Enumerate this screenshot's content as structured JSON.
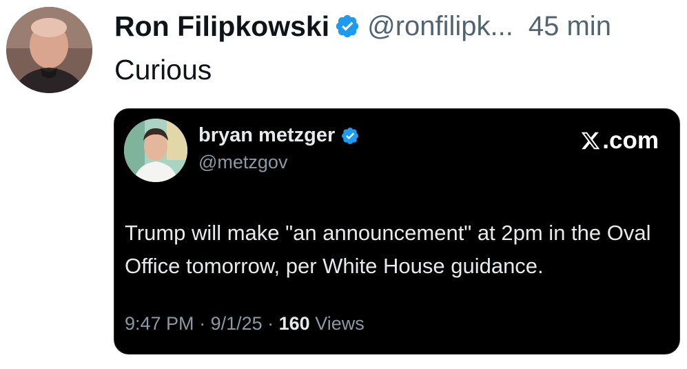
{
  "post": {
    "author_name": "Ron Filipkowski",
    "author_handle": "@ronfilipk...",
    "time_ago": "45 min",
    "text": "Curious",
    "verified_color": "#1d9bf0"
  },
  "quoted": {
    "author_name": "bryan metzger",
    "author_handle": "@metzgov",
    "site": ".com",
    "text": "Trump will make \"an announcement\" at 2pm in the Oval Office tomorrow, per White House guidance.",
    "time": "9:47 PM",
    "date": "9/1/25",
    "separator": " · ",
    "views_count": "160",
    "views_label": "Views"
  }
}
